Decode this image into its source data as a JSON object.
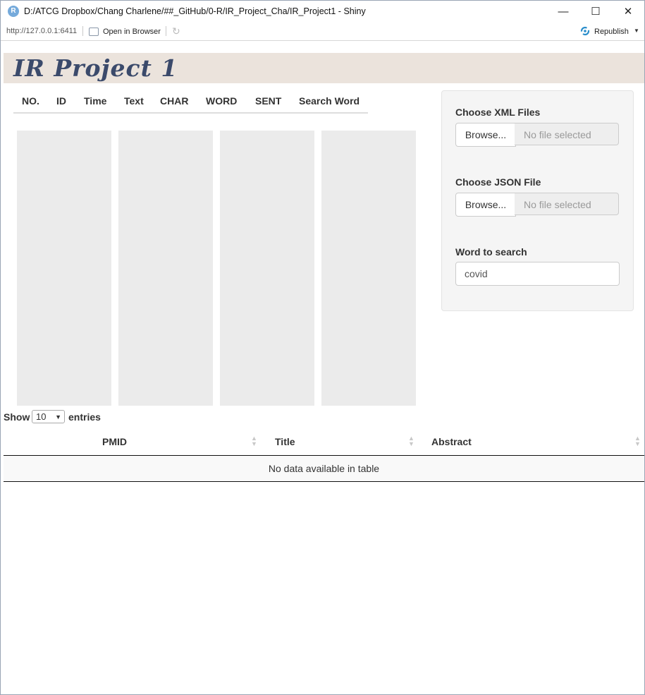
{
  "window": {
    "title": "D:/ATCG Dropbox/Chang Charlene/##_GitHub/0-R/IR_Project_Cha/IR_Project1 - Shiny",
    "app_icon_letter": "R",
    "minimize": "—",
    "maximize": "☐",
    "close": "✕"
  },
  "toolbar": {
    "url": "http://127.0.0.1:6411",
    "open_browser": "Open in Browser",
    "refresh_icon": "↻",
    "republish": "Republish",
    "republish_caret": "▼"
  },
  "header": {
    "title": "IR Project 1",
    "background": "#ebe3dc",
    "title_color": "#3b4a6b"
  },
  "tabs": [
    "NO.",
    "ID",
    "Time",
    "Text",
    "CHAR",
    "WORD",
    "SENT",
    "Search Word"
  ],
  "sidebar": {
    "xml": {
      "label": "Choose XML Files",
      "button": "Browse...",
      "placeholder": "No file selected"
    },
    "json": {
      "label": "Choose JSON File",
      "button": "Browse...",
      "placeholder": "No file selected"
    },
    "search": {
      "label": "Word to search",
      "value": "covid"
    }
  },
  "table": {
    "show_label": "Show",
    "page_length": "10",
    "entries_label": "entries",
    "columns": [
      "PMID",
      "Title",
      "Abstract"
    ],
    "empty_message": "No data available in table",
    "sort_icon": "▲▼"
  }
}
